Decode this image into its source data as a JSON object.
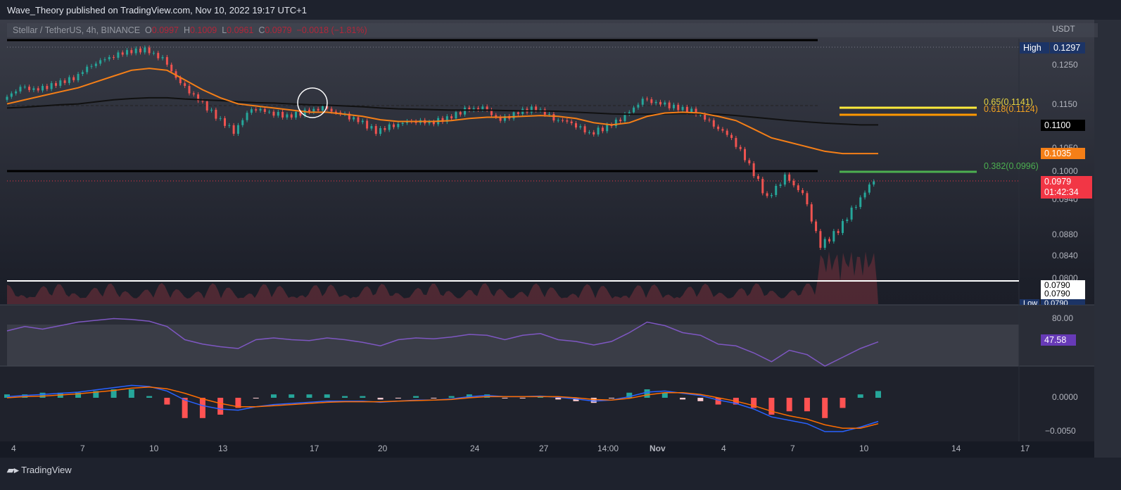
{
  "header": {
    "publish_text": "Wave_Theory published on TradingView.com, Nov 10, 2022 19:17 UTC+1"
  },
  "legend": {
    "symbol": "Stellar / TetherUS, 4h, BINANCE",
    "o_label": "O",
    "o": "0.0997",
    "h_label": "H",
    "h": "0.1009",
    "l_label": "L",
    "l": "0.0961",
    "c_label": "C",
    "c": "0.0979",
    "change": "−0.0018 (−1.81%)"
  },
  "price_axis": {
    "currency": "USDT",
    "ticks": [
      "0.1250",
      "0.1150",
      "0.1050",
      "0.1000",
      "0.0940",
      "0.0880",
      "0.0840",
      "0.0800"
    ],
    "high_label": "High",
    "high_value": "0.1297",
    "low_label": "Low",
    "low_value": "0.0790",
    "ma_black": "0.1100",
    "ema_orange": "0.1035",
    "last_price": "0.0979",
    "countdown": "01:42:34",
    "line_a": "0.0790",
    "line_b": "0.0790"
  },
  "fib": {
    "f065": "0.65(0.1141)",
    "f0618": "0.618(0.1124)",
    "f0382": "0.382(0.0996)"
  },
  "rsi": {
    "tick": "80.00",
    "value": "47.58"
  },
  "macd": {
    "ticks": [
      "0.0000",
      "−0.0050"
    ]
  },
  "x_axis": [
    "4",
    "7",
    "10",
    "13",
    "17",
    "20",
    "24",
    "27",
    "14:00",
    "Nov",
    "4",
    "7",
    "10",
    "14",
    "17"
  ],
  "footer": {
    "brand": "TradingView"
  },
  "colors": {
    "up": "#26a69a",
    "down": "#ef5350",
    "ema": "#f57f17",
    "rsi": "#7e57c2",
    "fib65": "#ffeb3b",
    "fib618": "#ff9800",
    "fib382": "#4caf50"
  },
  "chart_data": {
    "type": "candlestick",
    "symbol": "XLM/USDT",
    "interval": "4h",
    "closes": [
      0.116,
      0.119,
      0.1185,
      0.12,
      0.1215,
      0.125,
      0.127,
      0.1285,
      0.129,
      0.1265,
      0.12,
      0.116,
      0.112,
      0.1085,
      0.114,
      0.113,
      0.112,
      0.113,
      0.114,
      0.1125,
      0.111,
      0.1085,
      0.11,
      0.111,
      0.1105,
      0.1115,
      0.1135,
      0.114,
      0.111,
      0.113,
      0.114,
      0.1115,
      0.1105,
      0.108,
      0.1095,
      0.112,
      0.116,
      0.115,
      0.114,
      0.113,
      0.11,
      0.107,
      0.101,
      0.094,
      0.0985,
      0.095,
      0.085,
      0.088,
      0.093,
      0.0979
    ],
    "ema": [
      0.115,
      0.116,
      0.117,
      0.118,
      0.119,
      0.1205,
      0.122,
      0.1235,
      0.124,
      0.1235,
      0.121,
      0.1185,
      0.1165,
      0.115,
      0.1145,
      0.114,
      0.1135,
      0.113,
      0.113,
      0.1125,
      0.112,
      0.1112,
      0.1108,
      0.1108,
      0.1108,
      0.111,
      0.1115,
      0.1118,
      0.1118,
      0.112,
      0.1122,
      0.112,
      0.1115,
      0.1105,
      0.11,
      0.1105,
      0.112,
      0.1128,
      0.113,
      0.1128,
      0.112,
      0.111,
      0.109,
      0.107,
      0.106,
      0.105,
      0.104,
      0.1035,
      0.1035,
      0.1035
    ],
    "ma": [
      0.114,
      0.1142,
      0.1145,
      0.1148,
      0.115,
      0.1155,
      0.116,
      0.1163,
      0.1165,
      0.1165,
      0.1162,
      0.116,
      0.1158,
      0.1155,
      0.1153,
      0.1152,
      0.115,
      0.1148,
      0.1147,
      0.1145,
      0.1143,
      0.114,
      0.1138,
      0.1137,
      0.1136,
      0.1135,
      0.1135,
      0.1135,
      0.1134,
      0.1133,
      0.1133,
      0.1132,
      0.113,
      0.1128,
      0.1126,
      0.1125,
      0.1125,
      0.1126,
      0.1127,
      0.1126,
      0.1125,
      0.1122,
      0.1118,
      0.1114,
      0.111,
      0.1107,
      0.1104,
      0.1102,
      0.11,
      0.11
    ],
    "rsi": [
      60,
      65,
      62,
      66,
      70,
      72,
      74,
      73,
      71,
      65,
      50,
      45,
      42,
      40,
      50,
      52,
      50,
      49,
      52,
      50,
      47,
      43,
      50,
      52,
      51,
      53,
      56,
      55,
      50,
      55,
      57,
      50,
      48,
      44,
      48,
      58,
      70,
      66,
      58,
      55,
      45,
      43,
      35,
      25,
      38,
      33,
      20,
      30,
      40,
      47.58
    ],
    "macd": [
      0.0002,
      0.0004,
      0.0006,
      0.0008,
      0.001,
      0.0014,
      0.0018,
      0.0022,
      0.002,
      0.0012,
      -0.0004,
      -0.0014,
      -0.002,
      -0.0022,
      -0.0016,
      -0.0012,
      -0.001,
      -0.0008,
      -0.0006,
      -0.0006,
      -0.0006,
      -0.0008,
      -0.0006,
      -0.0004,
      -0.0004,
      -0.0002,
      0.0002,
      0.0004,
      0.0002,
      0.0002,
      0.0003,
      0.0001,
      -0.0002,
      -0.0006,
      -0.0004,
      0.0002,
      0.001,
      0.0012,
      0.0008,
      0.0004,
      -0.0004,
      -0.001,
      -0.002,
      -0.0034,
      -0.004,
      -0.0046,
      -0.006,
      -0.006,
      -0.0052,
      -0.0042
    ],
    "signal": [
      0.0,
      0.0002,
      0.0003,
      0.0005,
      0.0007,
      0.001,
      0.0013,
      0.0017,
      0.0019,
      0.0016,
      0.0008,
      -0.0002,
      -0.001,
      -0.0016,
      -0.0016,
      -0.0014,
      -0.0012,
      -0.001,
      -0.0008,
      -0.0007,
      -0.0007,
      -0.0007,
      -0.0006,
      -0.0005,
      -0.0004,
      -0.0003,
      0.0,
      0.0002,
      0.0002,
      0.0002,
      0.0002,
      0.0002,
      0.0,
      -0.0003,
      -0.0004,
      -0.0001,
      0.0005,
      0.0009,
      0.0009,
      0.0006,
      0.0,
      -0.0006,
      -0.0014,
      -0.0024,
      -0.0032,
      -0.0038,
      -0.0048,
      -0.0054,
      -0.0054,
      -0.0046
    ],
    "horizontal_lines": [
      0.1297,
      0.0995,
      0.079
    ],
    "ylim": [
      0.079,
      0.1297
    ]
  }
}
